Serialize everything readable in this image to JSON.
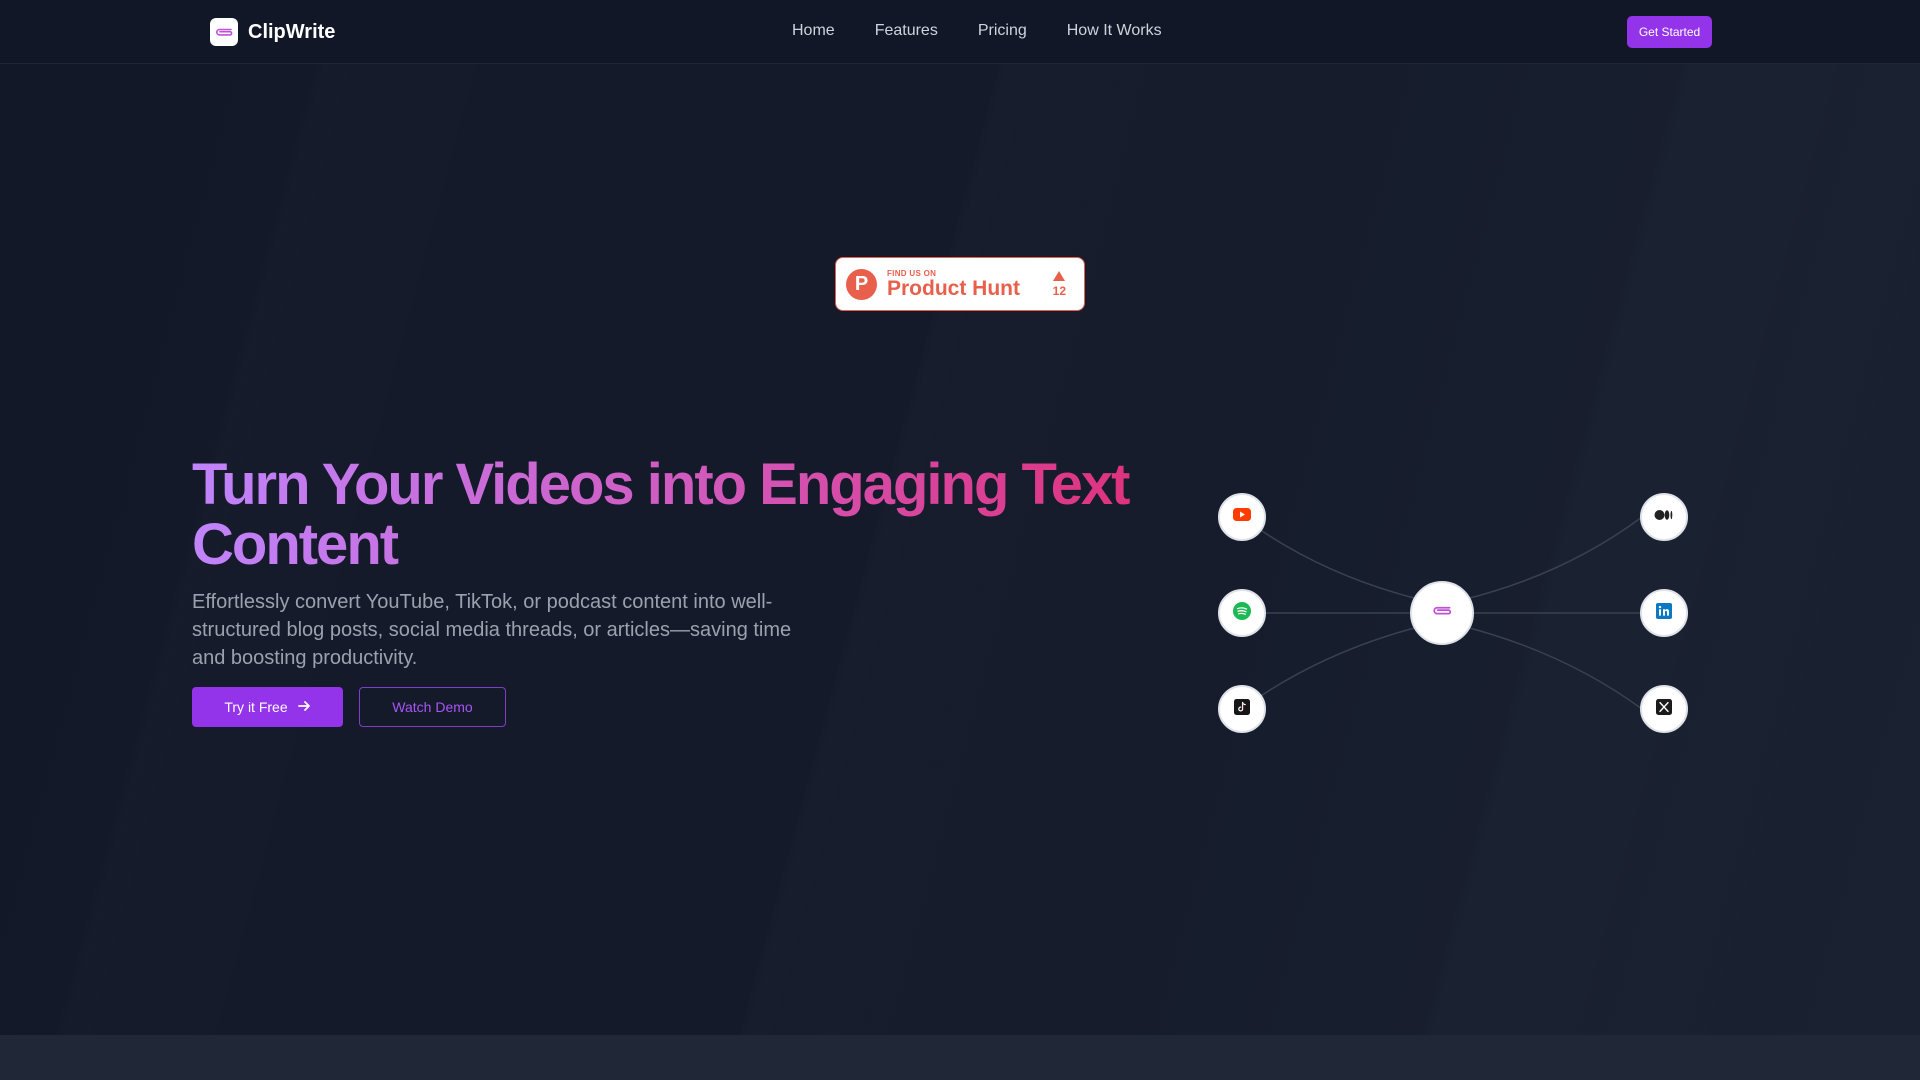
{
  "brand": {
    "name": "ClipWrite",
    "logo_icon": "paperclip-icon",
    "accent": "#9333ea"
  },
  "nav": {
    "links": [
      "Home",
      "Features",
      "Pricing",
      "How It Works"
    ],
    "cta_label": "Get Started"
  },
  "product_hunt": {
    "eyebrow": "FIND US ON",
    "name": "Product Hunt",
    "logo_letter": "P",
    "upvote_icon": "triangle-up-icon",
    "votes": "12",
    "color": "#e8604c"
  },
  "hero": {
    "headline": "Turn Your Videos into Engaging Text Content",
    "subtext": "Effortlessly convert YouTube, TikTok, or podcast content into well-structured blog posts, social media threads, or articles—saving time and boosting productivity.",
    "primary_label": "Try it Free",
    "primary_icon": "arrow-right-icon",
    "secondary_label": "Watch Demo"
  },
  "diagram": {
    "inputs": [
      {
        "name": "YouTube",
        "icon": "youtube-icon",
        "color": "#ff3d00"
      },
      {
        "name": "Spotify",
        "icon": "spotify-icon",
        "color": "#1db954"
      },
      {
        "name": "TikTok",
        "icon": "tiktok-icon",
        "color": "#111111"
      }
    ],
    "center": {
      "name": "ClipWrite",
      "icon": "paperclip-icon",
      "color": "#c04fd8"
    },
    "outputs": [
      {
        "name": "Medium",
        "icon": "medium-icon",
        "color": "#222222"
      },
      {
        "name": "LinkedIn",
        "icon": "linkedin-icon",
        "color": "#0a78c2"
      },
      {
        "name": "X",
        "icon": "x-icon",
        "color": "#111111"
      }
    ]
  }
}
